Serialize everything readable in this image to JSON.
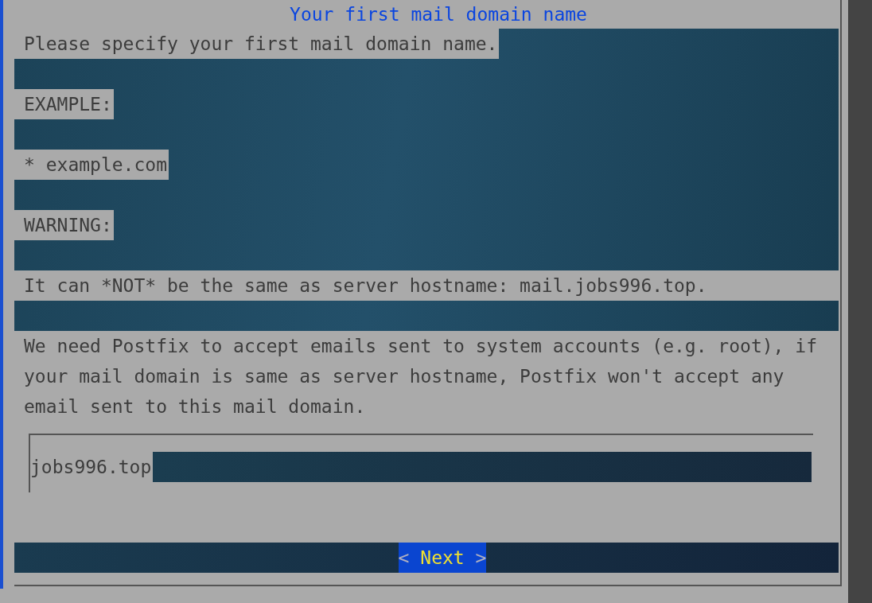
{
  "dialog": {
    "title": "Your first mail domain name",
    "lines": [
      {
        "kind": "text",
        "text": "Please specify your first mail domain name."
      },
      {
        "kind": "blank"
      },
      {
        "kind": "text",
        "text": "EXAMPLE:"
      },
      {
        "kind": "blank"
      },
      {
        "kind": "text",
        "text": "* example.com"
      },
      {
        "kind": "blank"
      },
      {
        "kind": "text",
        "text": "WARNING:"
      },
      {
        "kind": "blank"
      },
      {
        "kind": "wide",
        "text": "It can *NOT* be the same as server hostname: mail.jobs996.top."
      },
      {
        "kind": "blank"
      },
      {
        "kind": "paragraph",
        "text": "We need Postfix to accept emails sent to system accounts (e.g. root), if your mail domain is same as server hostname, Postfix won't accept any email sent to this mail domain."
      }
    ],
    "input": {
      "value": "jobs996.top"
    },
    "buttons": [
      {
        "left": "<",
        "label": "Next",
        "right": ">",
        "selected": true
      }
    ]
  }
}
